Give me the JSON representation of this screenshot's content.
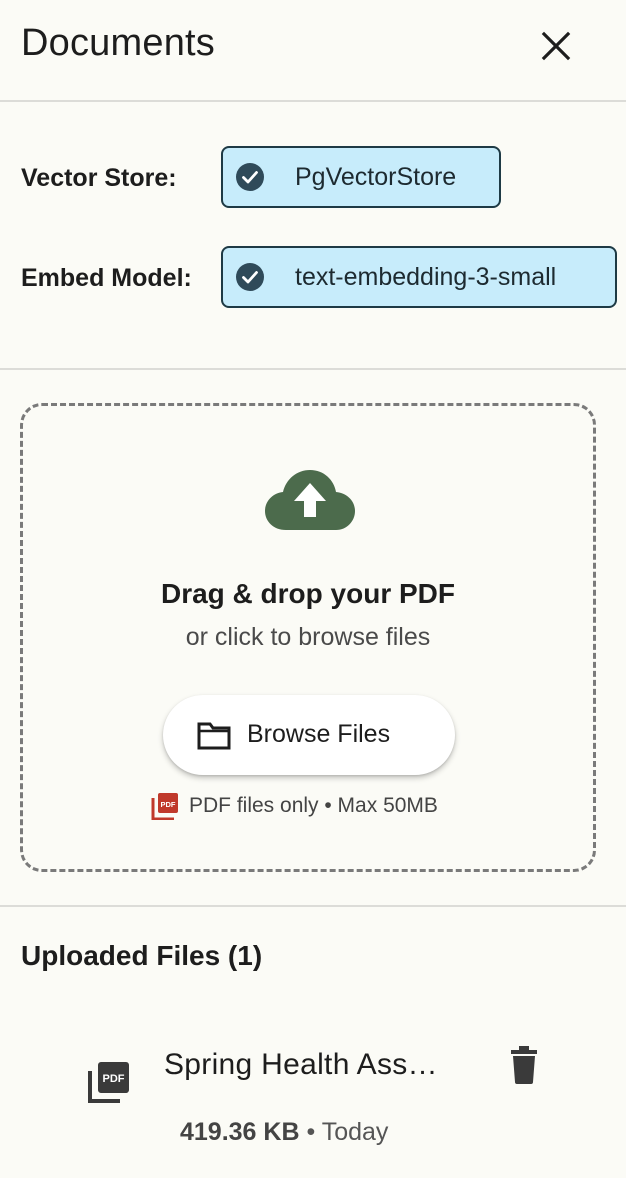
{
  "header": {
    "title": "Documents",
    "close_icon": "close-icon"
  },
  "config": {
    "vector_store_label": "Vector Store:",
    "vector_store_value": "PgVectorStore",
    "embed_model_label": "Embed Model:",
    "embed_model_value": "text-embedding-3-small",
    "chip_icon": "check-circle-icon"
  },
  "dropzone": {
    "icon": "cloud-upload-icon",
    "title": "Drag & drop your PDF",
    "subtitle": "or click to browse files",
    "browse_label": "Browse Files",
    "browse_icon": "folder-icon",
    "limits_icon": "pdf-icon",
    "limits_text": "PDF files only • Max 50MB"
  },
  "uploaded": {
    "title": "Uploaded Files (1)",
    "files": [
      {
        "name": "Spring Health Ass…",
        "size": "419.36 KB",
        "date_sep": " • Today",
        "icon": "pdf-file-icon",
        "delete_icon": "trash-icon"
      }
    ]
  },
  "colors": {
    "background": "#fbfbf6",
    "chip_fill": "#c7ecfb",
    "chip_border": "#1e3a45",
    "check_fill": "#2f4a59",
    "upload_icon": "#4c6b4c",
    "pdf_red": "#c0392b",
    "divider": "#dcdcd8"
  }
}
